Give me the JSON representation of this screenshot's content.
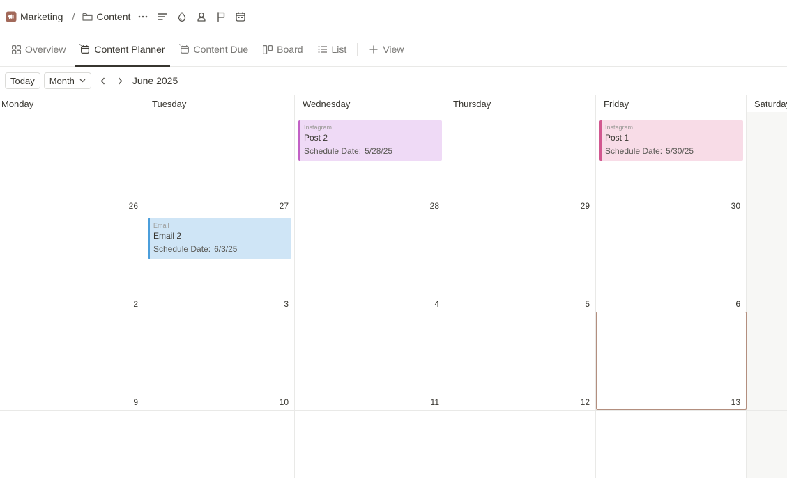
{
  "breadcrumb": {
    "workspace": "Marketing",
    "separator": "/",
    "page": "Content"
  },
  "toolbar_icons": [
    "more-icon",
    "properties-icon",
    "drop-icon",
    "person-icon",
    "flag-icon",
    "calendar-icon"
  ],
  "tabs": [
    {
      "label": "Overview",
      "icon": "gallery-icon",
      "active": false
    },
    {
      "label": "Content Planner",
      "icon": "calendar-icon",
      "active": true
    },
    {
      "label": "Content Due",
      "icon": "calendar-icon",
      "active": false
    },
    {
      "label": "Board",
      "icon": "board-icon",
      "active": false
    },
    {
      "label": "List",
      "icon": "list-icon",
      "active": false
    }
  ],
  "add_view_label": "View",
  "controls": {
    "today_label": "Today",
    "range_label": "Month",
    "month_label": "June 2025"
  },
  "calendar": {
    "day_names": [
      "Monday",
      "Tuesday",
      "Wednesday",
      "Thursday",
      "Friday",
      "Saturday"
    ],
    "weeks": [
      [
        "26",
        "27",
        "28",
        "29",
        "30"
      ],
      [
        "2",
        "3",
        "4",
        "5",
        "6"
      ],
      [
        "9",
        "10",
        "11",
        "12",
        "13"
      ]
    ],
    "today": "13",
    "events": [
      {
        "category": "Instagram",
        "title": "Post 2",
        "prop_key": "Schedule Date:",
        "prop_value": "5/28/25",
        "accent": "#c261c6",
        "bg": "#efdaf6"
      },
      {
        "category": "Instagram",
        "title": "Post 1",
        "prop_key": "Schedule Date:",
        "prop_value": "5/30/25",
        "accent": "#d1578f",
        "bg": "#f8dce7"
      },
      {
        "category": "Email",
        "title": "Email 2",
        "prop_key": "Schedule Date:",
        "prop_value": "6/3/25",
        "accent": "#4b9edb",
        "bg": "#cfe5f6"
      }
    ]
  }
}
